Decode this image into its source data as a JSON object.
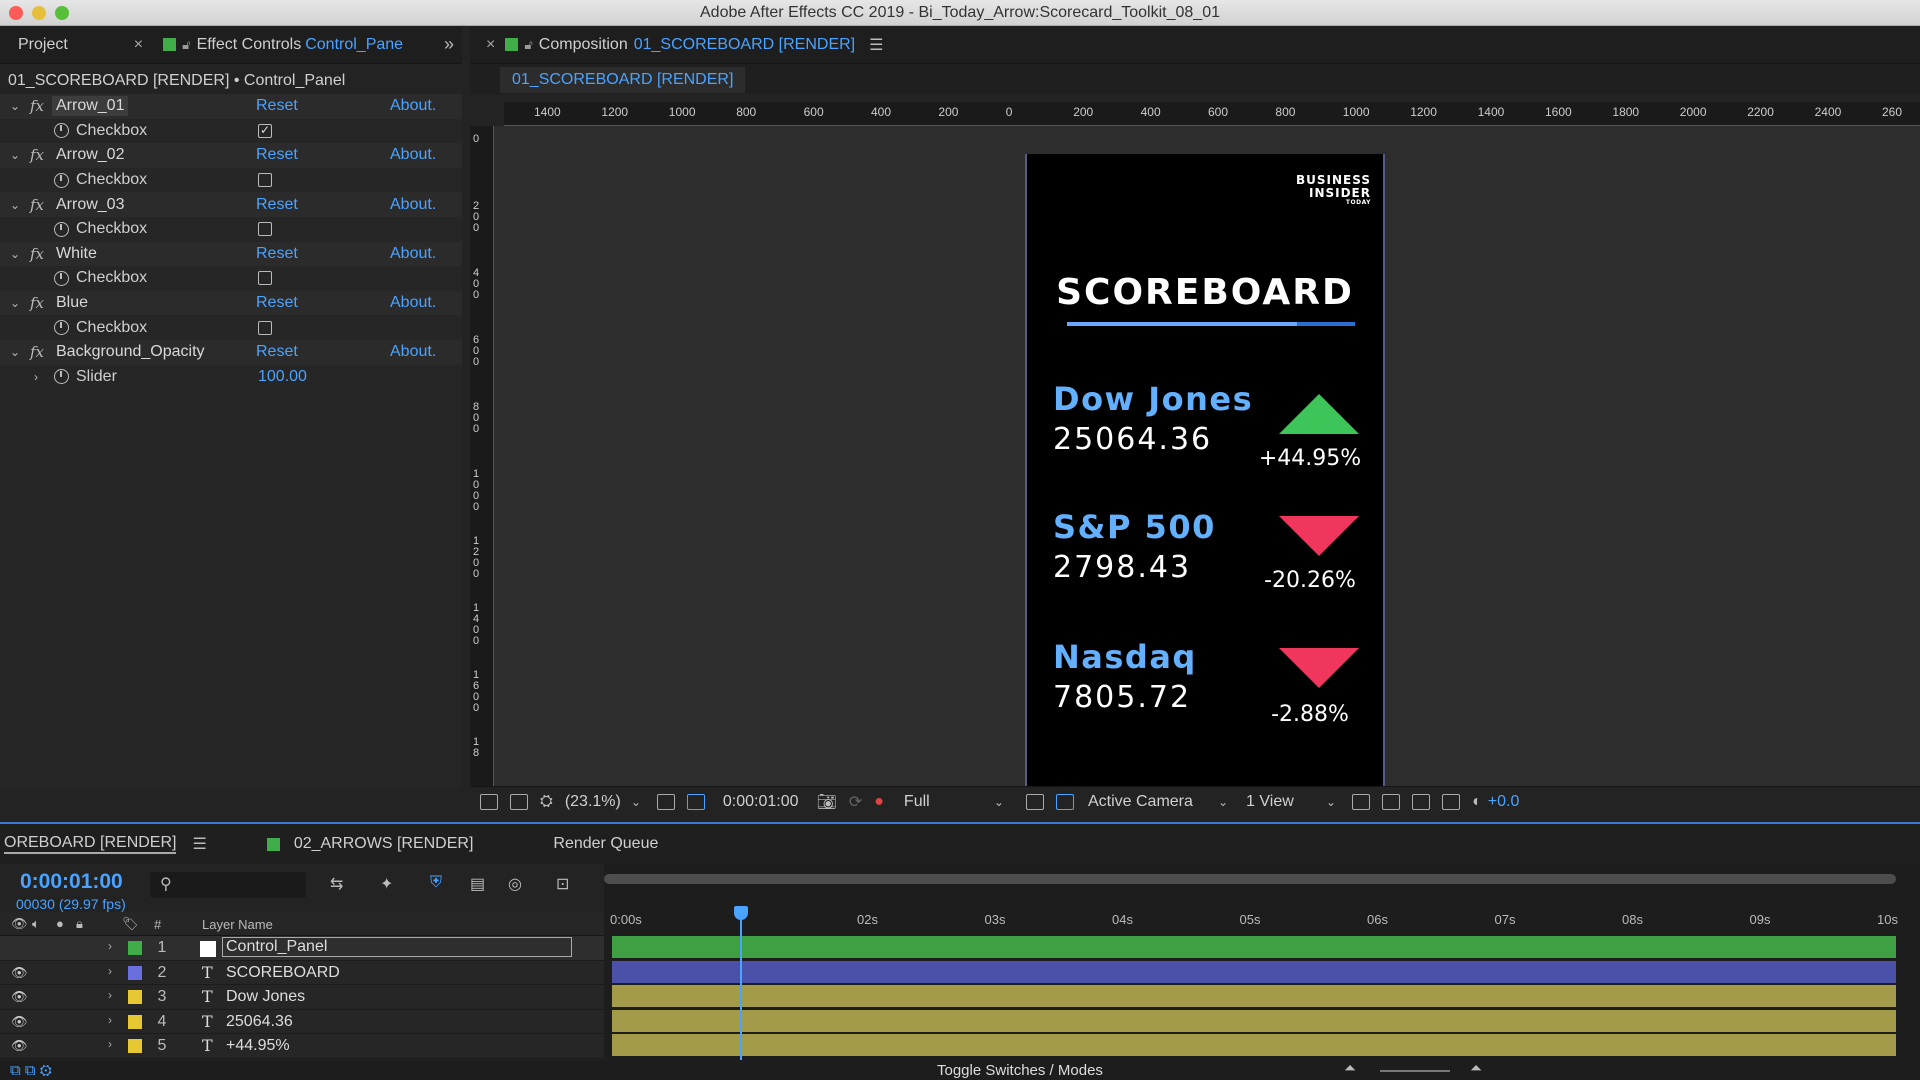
{
  "window": {
    "title": "Adobe After Effects CC 2019 - Bi_Today_Arrow:Scorecard_Toolkit_08_01"
  },
  "left_panel": {
    "tab_project": "Project",
    "tab_effect_prefix": "Effect Controls",
    "tab_effect_layer": "Control_Pane",
    "breadcrumb": "01_SCOREBOARD [RENDER] • Control_Panel",
    "reset": "Reset",
    "about": "About.",
    "effects": [
      {
        "name": "Arrow_01",
        "param": "Checkbox",
        "checked": true
      },
      {
        "name": "Arrow_02",
        "param": "Checkbox",
        "checked": false
      },
      {
        "name": "Arrow_03",
        "param": "Checkbox",
        "checked": false
      },
      {
        "name": "White",
        "param": "Checkbox",
        "checked": false
      },
      {
        "name": "Blue",
        "param": "Checkbox",
        "checked": false
      },
      {
        "name": "Background_Opacity",
        "param": "Slider",
        "value": "100.00"
      }
    ]
  },
  "composition": {
    "tab_prefix": "Composition",
    "tab_name": "01_SCOREBOARD [RENDER]",
    "subtab": "01_SCOREBOARD [RENDER]",
    "ruler_h": [
      "1400",
      "1200",
      "1000",
      "800",
      "600",
      "400",
      "200",
      "0",
      "200",
      "400",
      "600",
      "800",
      "1000",
      "1200",
      "1400",
      "1600",
      "1800",
      "2000",
      "2200",
      "2400",
      "260"
    ],
    "ruler_v": [
      "0",
      "200",
      "400",
      "600",
      "800",
      "1000",
      "1200",
      "1400",
      "1600",
      "18"
    ],
    "frame": {
      "logo_line1": "BUSINESS",
      "logo_line2": "INSIDER",
      "logo_line3": "TODAY",
      "title": "SCOREBOARD",
      "stocks": [
        {
          "name": "Dow Jones",
          "value": "25064.36",
          "change": "+44.95%",
          "direction": "up"
        },
        {
          "name": "S&P 500",
          "value": "2798.43",
          "change": "-20.26%",
          "direction": "down"
        },
        {
          "name": "Nasdaq",
          "value": "7805.72",
          "change": "-2.88%",
          "direction": "down"
        }
      ],
      "colors": {
        "up": "#3ec55a",
        "down": "#f0365c",
        "name": "#63b0ff"
      }
    },
    "toolbar": {
      "zoom": "(23.1%)",
      "time": "0:00:01:00",
      "resolution": "Full",
      "camera": "Active Camera",
      "views": "1 View",
      "exposure": "+0.0"
    }
  },
  "timeline": {
    "tab_active": "OREBOARD [RENDER]",
    "tab_2": "02_ARROWS [RENDER]",
    "tab_3": "Render Queue",
    "timecode": "0:00:01:00",
    "fps": "00030 (29.97 fps)",
    "col_hash": "#",
    "col_layer_name": "Layer Name",
    "time_ticks": [
      "0:00s",
      "02s",
      "03s",
      "04s",
      "05s",
      "06s",
      "07s",
      "08s",
      "09s",
      "10s"
    ],
    "layers": [
      {
        "num": "1",
        "type": "",
        "name": "Control_Panel",
        "color": "#3fae49",
        "bar": "#3fa043"
      },
      {
        "num": "2",
        "type": "T",
        "name": "SCOREBOARD",
        "color": "#6a6fe0",
        "bar": "#4b51a8"
      },
      {
        "num": "3",
        "type": "T",
        "name": "Dow Jones",
        "color": "#e6c832",
        "bar": "#a39a4a"
      },
      {
        "num": "4",
        "type": "T",
        "name": "25064.36",
        "color": "#e6c832",
        "bar": "#a39a4a"
      },
      {
        "num": "5",
        "type": "T",
        "name": "+44.95%",
        "color": "#e6c832",
        "bar": "#a39a4a"
      }
    ],
    "toggle_label": "Toggle Switches / Modes"
  }
}
